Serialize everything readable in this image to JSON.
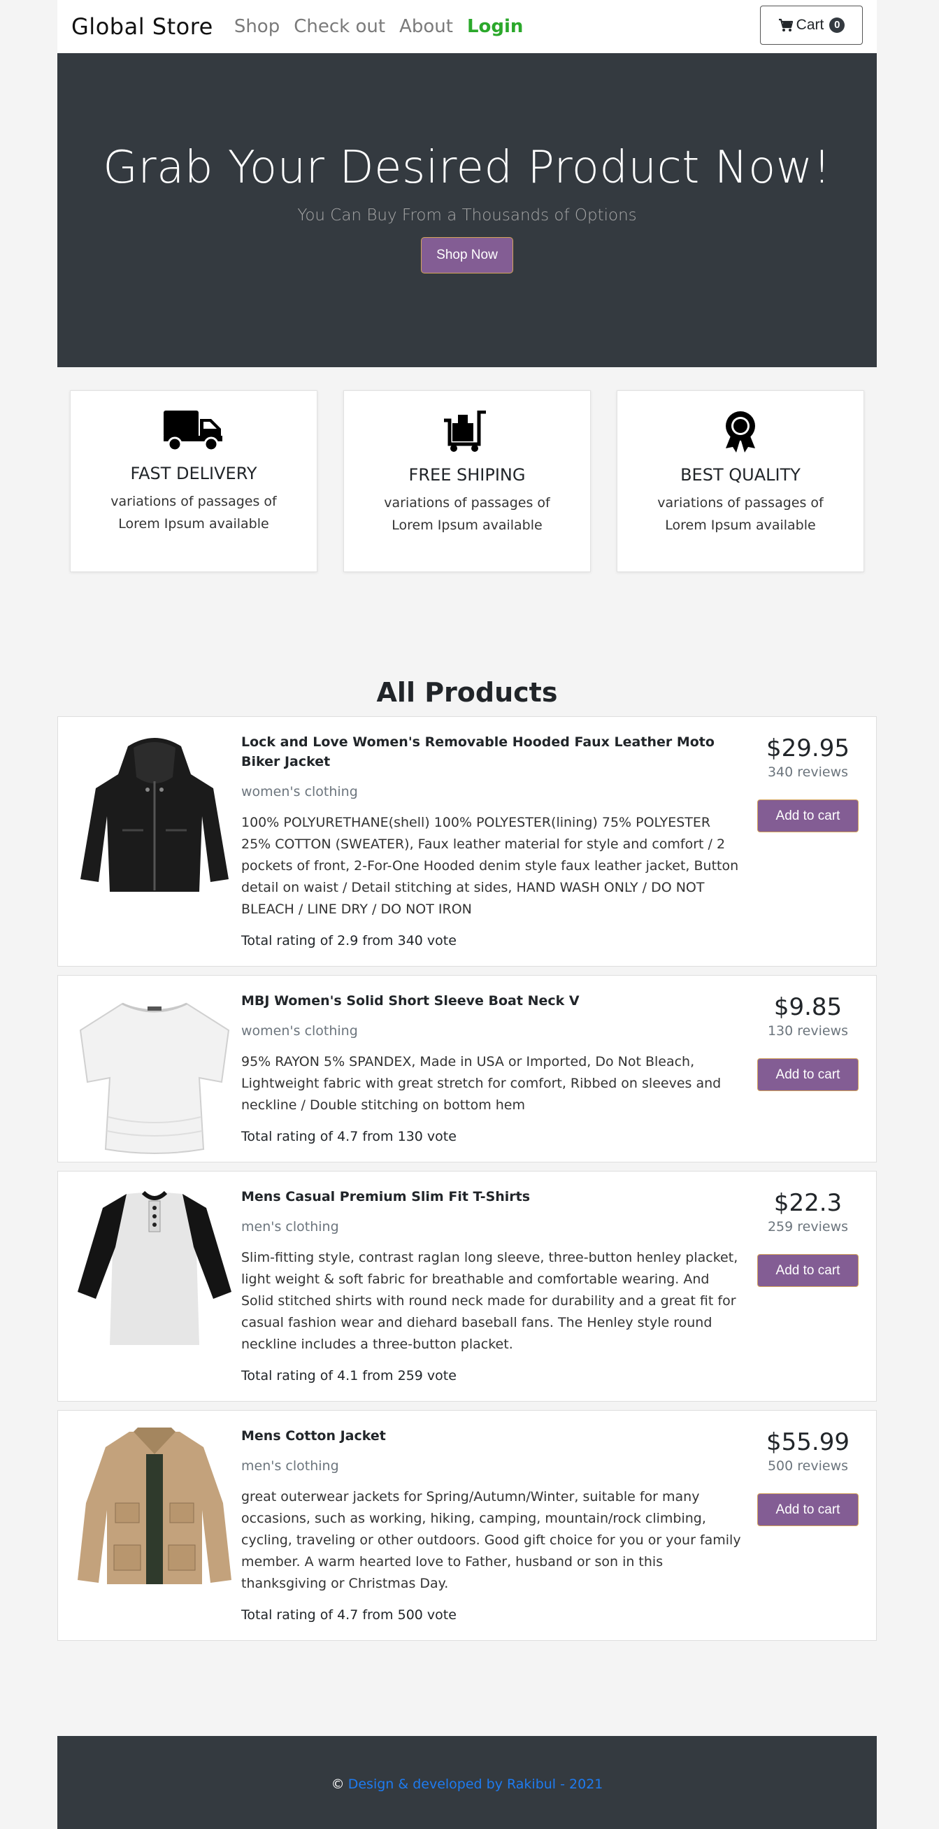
{
  "navbar": {
    "brand": "Global Store",
    "links": [
      "Shop",
      "Check out",
      "About"
    ],
    "login": "Login",
    "cart_label": "Cart",
    "cart_count": "0"
  },
  "hero": {
    "title": "Grab Your Desired Product Now!",
    "subtitle": "You Can Buy From a Thousands of Options",
    "button": "Shop Now"
  },
  "features": [
    {
      "icon": "truck-icon",
      "title": "FAST DELIVERY",
      "text": "variations of passages of Lorem Ipsum available"
    },
    {
      "icon": "cart-dolly-icon",
      "title": "FREE SHIPING",
      "text": "variations of passages of Lorem Ipsum available"
    },
    {
      "icon": "award-ribbon-icon",
      "title": "BEST QUALITY",
      "text": "variations of passages of Lorem Ipsum available"
    }
  ],
  "section_title": "All Products",
  "products": [
    {
      "title": "Lock and Love Women's Removable Hooded Faux Leather Moto Biker Jacket",
      "category": "women's clothing",
      "description": "100% POLYURETHANE(shell) 100% POLYESTER(lining) 75% POLYESTER 25% COTTON (SWEATER), Faux leather material for style and comfort / 2 pockets of front, 2-For-One Hooded denim style faux leather jacket, Button detail on waist / Detail stitching at sides, HAND WASH ONLY / DO NOT BLEACH / LINE DRY / DO NOT IRON",
      "rating": "Total rating of 2.9 from 340 vote",
      "price": "$29.95",
      "reviews": "340 reviews",
      "button": "Add to cart",
      "image": "black-leather-jacket"
    },
    {
      "title": "MBJ Women's Solid Short Sleeve Boat Neck V",
      "category": "women's clothing",
      "description": "95% RAYON 5% SPANDEX, Made in USA or Imported, Do Not Bleach, Lightweight fabric with great stretch for comfort, Ribbed on sleeves and neckline / Double stitching on bottom hem",
      "rating": "Total rating of 4.7 from 130 vote",
      "price": "$9.85",
      "reviews": "130 reviews",
      "button": "Add to cart",
      "image": "white-boat-neck-top"
    },
    {
      "title": "Mens Casual Premium Slim Fit T-Shirts",
      "category": "men's clothing",
      "description": "Slim-fitting style, contrast raglan long sleeve, three-button henley placket, light weight & soft fabric for breathable and comfortable wearing. And Solid stitched shirts with round neck made for durability and a great fit for casual fashion wear and diehard baseball fans. The Henley style round neckline includes a three-button placket.",
      "rating": "Total rating of 4.1 from 259 vote",
      "price": "$22.3",
      "reviews": "259 reviews",
      "button": "Add to cart",
      "image": "raglan-henley-shirt"
    },
    {
      "title": "Mens Cotton Jacket",
      "category": "men's clothing",
      "description": "great outerwear jackets for Spring/Autumn/Winter, suitable for many occasions, such as working, hiking, camping, mountain/rock climbing, cycling, traveling or other outdoors. Good gift choice for you or your family member. A warm hearted love to Father, husband or son in this thanksgiving or Christmas Day.",
      "rating": "Total rating of 4.7 from 500 vote",
      "price": "$55.99",
      "reviews": "500 reviews",
      "button": "Add to cart",
      "image": "khaki-cotton-jacket"
    }
  ],
  "footer": {
    "copyright": "©",
    "credit": "Design & developed by Rakibul - 2021"
  },
  "colors": {
    "dark": "#343a40",
    "accent_button": "#835d94",
    "login_green": "#2ba82b",
    "footer_link": "#1e7bf0"
  }
}
